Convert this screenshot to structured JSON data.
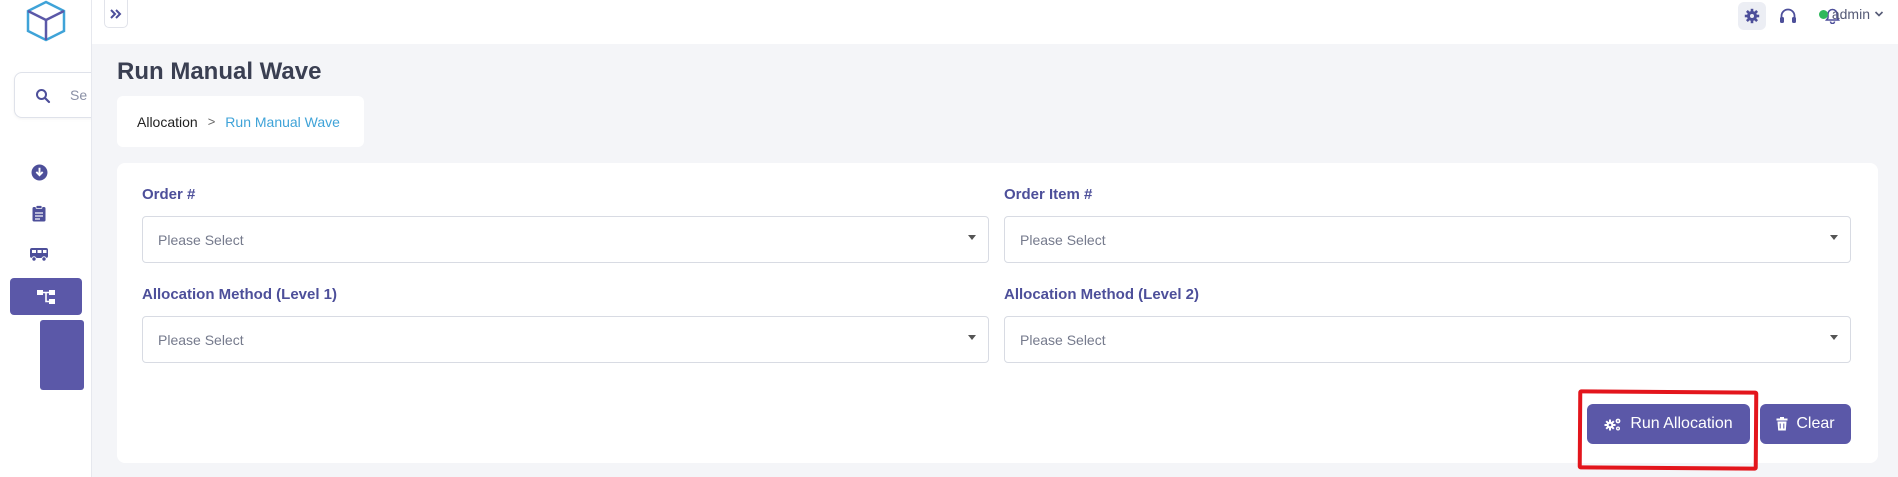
{
  "sidebar": {
    "search_placeholder": "Se",
    "nav_icons": [
      "download-circle-icon",
      "clipboard-icon",
      "truck-icon",
      "wave-tree-icon"
    ],
    "active_item": "wave-tree-icon"
  },
  "topbar": {
    "icons": [
      "settings-gear-icon",
      "headset-icon",
      "bell-icon"
    ],
    "user_name": "admin",
    "user_status_color": "#2eb85c"
  },
  "page": {
    "title": "Run Manual Wave",
    "breadcrumb": {
      "parent": "Allocation",
      "separator": ">",
      "current": "Run Manual Wave"
    }
  },
  "form": {
    "order": {
      "label": "Order #",
      "placeholder": "Please Select"
    },
    "order_item": {
      "label": "Order Item #",
      "placeholder": "Please Select"
    },
    "method_level1": {
      "label": "Allocation Method (Level 1)",
      "placeholder": "Please Select"
    },
    "method_level2": {
      "label": "Allocation Method (Level 2)",
      "placeholder": "Please Select"
    }
  },
  "actions": {
    "run_allocation": "Run Allocation",
    "clear": "Clear"
  },
  "colors": {
    "primary": "#5b58a8",
    "label": "#4d4f9a",
    "breadcrumb_current": "#3fa3d8",
    "highlight": "#e3151c"
  }
}
